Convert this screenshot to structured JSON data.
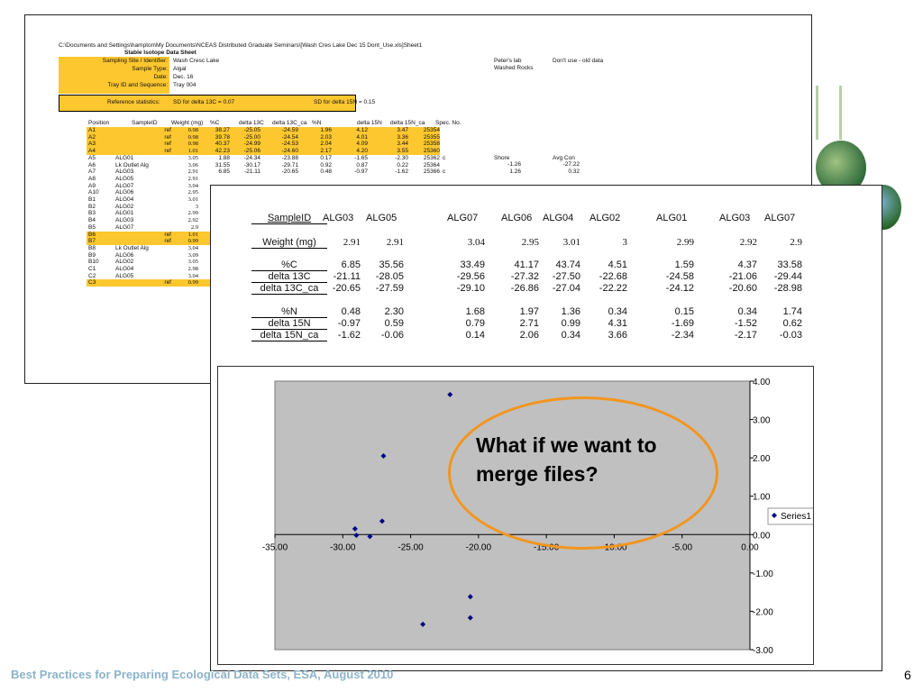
{
  "decor": {
    "tree_icon": "tree-graphic",
    "globe_icon": "globe-photo"
  },
  "sheet1": {
    "path": "C:\\Documents and Settings\\hampton\\My Documents\\NCEAS Distributed Graduate Seminars\\[Wash Cres Lake Dec 15 Dont_Use.xls]Sheet1",
    "title": "Stable Isotope Data Sheet",
    "meta": [
      {
        "label": "Sampling Site / Identifier:",
        "value": "Wash Cresc Lake"
      },
      {
        "label": "Sample Type:",
        "value": "Algal"
      },
      {
        "label": "Date:",
        "value": "Dec. 16"
      },
      {
        "label": "Tray ID and Sequence:",
        "value": "Tray 004"
      }
    ],
    "lab_note": {
      "lab": "Peter's lab",
      "washed": "Washed Rocks",
      "dont_use": "Don't use - old data"
    },
    "ref_stats": {
      "label": "Reference statistics:",
      "sd_c": "SD for delta 13C = 0.07",
      "sd_n": "SD for delta 15N = 0.15"
    },
    "headers": [
      "Position",
      "SampleID",
      "Weight (mg)",
      "%C",
      "delta 13C",
      "delta 13C_ca",
      "%N",
      "delta 15N",
      "delta 15N_ca",
      "Spec. No."
    ],
    "rows": [
      {
        "pos": "A1",
        "id": "",
        "ref": "ref",
        "w": "0.98",
        "c": "38.27",
        "d13": "-25.05",
        "d13ca": "-24.59",
        "n": "1.96",
        "d15": "4.12",
        "d15ca": "3.47",
        "spec": "25354",
        "hl": true
      },
      {
        "pos": "A2",
        "id": "",
        "ref": "ref",
        "w": "0.98",
        "c": "39.78",
        "d13": "-25.00",
        "d13ca": "-24.54",
        "n": "2.03",
        "d15": "4.01",
        "d15ca": "3.36",
        "spec": "25355",
        "hl": true
      },
      {
        "pos": "A3",
        "id": "",
        "ref": "ref",
        "w": "0.98",
        "c": "40.37",
        "d13": "-24.99",
        "d13ca": "-24.53",
        "n": "2.04",
        "d15": "4.09",
        "d15ca": "3.44",
        "spec": "25358",
        "hl": true
      },
      {
        "pos": "A4",
        "id": "",
        "ref": "ref",
        "w": "1.01",
        "c": "42.23",
        "d13": "-25.06",
        "d13ca": "-24.60",
        "n": "2.17",
        "d15": "4.20",
        "d15ca": "3.55",
        "spec": "25360",
        "hl": true
      },
      {
        "pos": "A5",
        "id": "ALG01",
        "ref": "",
        "w": "3.05",
        "c": "1.88",
        "d13": "-24.34",
        "d13ca": "-23.88",
        "n": "0.17",
        "d15": "-1.65",
        "d15ca": "-2.30",
        "spec": "25362",
        "hl": false
      },
      {
        "pos": "A6",
        "id": "Lk Outlet Alg",
        "ref": "",
        "w": "3.06",
        "c": "31.55",
        "d13": "-30.17",
        "d13ca": "-29.71",
        "n": "0.92",
        "d15": "0.87",
        "d15ca": "0.22",
        "spec": "25364",
        "hl": false
      },
      {
        "pos": "A7",
        "id": "ALG03",
        "ref": "",
        "w": "2.91",
        "c": "6.85",
        "d13": "-21.11",
        "d13ca": "-20.65",
        "n": "0.48",
        "d15": "-0.97",
        "d15ca": "-1.62",
        "spec": "25366",
        "hl": false
      },
      {
        "pos": "A8",
        "id": "ALG05",
        "ref": "",
        "w": "2.91",
        "c": "",
        "d13": "",
        "d13ca": "",
        "n": "",
        "d15": "",
        "d15ca": "",
        "spec": "",
        "hl": false
      },
      {
        "pos": "A9",
        "id": "ALG07",
        "ref": "",
        "w": "3.04",
        "c": "",
        "d13": "",
        "d13ca": "",
        "n": "",
        "d15": "",
        "d15ca": "",
        "spec": "",
        "hl": false
      },
      {
        "pos": "A10",
        "id": "ALG06",
        "ref": "",
        "w": "2.95",
        "c": "",
        "d13": "",
        "d13ca": "",
        "n": "",
        "d15": "",
        "d15ca": "",
        "spec": "",
        "hl": false
      },
      {
        "pos": "B1",
        "id": "ALG04",
        "ref": "",
        "w": "3.01",
        "c": "",
        "d13": "",
        "d13ca": "",
        "n": "",
        "d15": "",
        "d15ca": "",
        "spec": "",
        "hl": false
      },
      {
        "pos": "B2",
        "id": "ALG02",
        "ref": "",
        "w": "3",
        "c": "",
        "d13": "",
        "d13ca": "",
        "n": "",
        "d15": "",
        "d15ca": "",
        "spec": "",
        "hl": false
      },
      {
        "pos": "B3",
        "id": "ALG01",
        "ref": "",
        "w": "2.99",
        "c": "",
        "d13": "",
        "d13ca": "",
        "n": "",
        "d15": "",
        "d15ca": "",
        "spec": "",
        "hl": false
      },
      {
        "pos": "B4",
        "id": "ALG03",
        "ref": "",
        "w": "2.92",
        "c": "",
        "d13": "",
        "d13ca": "",
        "n": "",
        "d15": "",
        "d15ca": "",
        "spec": "",
        "hl": false
      },
      {
        "pos": "B5",
        "id": "ALG07",
        "ref": "",
        "w": "2.9",
        "c": "",
        "d13": "",
        "d13ca": "",
        "n": "",
        "d15": "",
        "d15ca": "",
        "spec": "",
        "hl": false
      },
      {
        "pos": "B6",
        "id": "",
        "ref": "ref",
        "w": "1.01",
        "c": "",
        "d13": "",
        "d13ca": "",
        "n": "",
        "d15": "",
        "d15ca": "",
        "spec": "",
        "hl": true
      },
      {
        "pos": "B7",
        "id": "",
        "ref": "ref",
        "w": "0.99",
        "c": "",
        "d13": "",
        "d13ca": "",
        "n": "",
        "d15": "",
        "d15ca": "",
        "spec": "",
        "hl": true
      },
      {
        "pos": "B8",
        "id": "Lk Outlet Alg",
        "ref": "",
        "w": "3.04",
        "c": "",
        "d13": "",
        "d13ca": "",
        "n": "",
        "d15": "",
        "d15ca": "",
        "spec": "",
        "hl": false
      },
      {
        "pos": "B9",
        "id": "ALG06",
        "ref": "",
        "w": "3.09",
        "c": "",
        "d13": "",
        "d13ca": "",
        "n": "",
        "d15": "",
        "d15ca": "",
        "spec": "",
        "hl": false
      },
      {
        "pos": "B10",
        "id": "ALG02",
        "ref": "",
        "w": "3.05",
        "c": "",
        "d13": "",
        "d13ca": "",
        "n": "",
        "d15": "",
        "d15ca": "",
        "spec": "",
        "hl": false
      },
      {
        "pos": "C1",
        "id": "ALG04",
        "ref": "",
        "w": "2.98",
        "c": "",
        "d13": "",
        "d13ca": "",
        "n": "",
        "d15": "",
        "d15ca": "",
        "spec": "",
        "hl": false
      },
      {
        "pos": "C2",
        "id": "ALG05",
        "ref": "",
        "w": "3.04",
        "c": "",
        "d13": "",
        "d13ca": "",
        "n": "",
        "d15": "",
        "d15ca": "",
        "spec": "",
        "hl": false
      },
      {
        "pos": "C3",
        "id": "",
        "ref": "ref",
        "w": "0.99",
        "c": "",
        "d13": "",
        "d13ca": "",
        "n": "",
        "d15": "",
        "d15ca": "",
        "spec": "",
        "hl": true
      }
    ],
    "c_marks": [
      "c",
      "",
      "c"
    ],
    "side": {
      "shore_label": "Shore",
      "avg_label": "Avg Con",
      "rows": [
        {
          "a": "-1.26",
          "b": "-27.22"
        },
        {
          "a": "1.26",
          "b": "0.32"
        }
      ]
    }
  },
  "sheet2": {
    "table": {
      "header_label": "SampleID",
      "columns": [
        "ALG03",
        "ALG05",
        "ALG07",
        "ALG06",
        "ALG04",
        "ALG02",
        "ALG01",
        "ALG03",
        "ALG07"
      ],
      "weight": {
        "label": "Weight (mg)",
        "values": [
          "2.91",
          "2.91",
          "3.04",
          "2.95",
          "3.01",
          "3",
          "2.99",
          "2.92",
          "2.9"
        ]
      },
      "group1": [
        {
          "label": "%C",
          "values": [
            "6.85",
            "35.56",
            "33.49",
            "41.17",
            "43.74",
            "4.51",
            "1.59",
            "4.37",
            "33.58"
          ]
        },
        {
          "label": "delta 13C",
          "values": [
            "-21.11",
            "-28.05",
            "-29.56",
            "-27.32",
            "-27.50",
            "-22.68",
            "-24.58",
            "-21.06",
            "-29.44"
          ]
        },
        {
          "label": "delta 13C_ca",
          "values": [
            "-20.65",
            "-27.59",
            "-29.10",
            "-26.86",
            "-27.04",
            "-22.22",
            "-24.12",
            "-20.60",
            "-28.98"
          ]
        }
      ],
      "group2": [
        {
          "label": "%N",
          "values": [
            "0.48",
            "2.30",
            "1.68",
            "1.97",
            "1.36",
            "0.34",
            "0.15",
            "0.34",
            "1.74"
          ]
        },
        {
          "label": "delta 15N",
          "values": [
            "-0.97",
            "0.59",
            "0.79",
            "2.71",
            "0.99",
            "4.31",
            "-1.69",
            "-1.52",
            "0.62"
          ]
        },
        {
          "label": "delta 15N_ca",
          "values": [
            "-1.62",
            "-0.06",
            "0.14",
            "2.06",
            "0.34",
            "3.66",
            "-2.34",
            "-2.17",
            "-0.03"
          ]
        }
      ]
    }
  },
  "chart_data": {
    "type": "scatter",
    "series": [
      {
        "name": "Series1",
        "points": [
          [
            -22.1,
            3.65
          ],
          [
            -27.0,
            2.05
          ],
          [
            -27.1,
            0.35
          ],
          [
            -28.0,
            -0.05
          ],
          [
            -29.1,
            0.15
          ],
          [
            -29.0,
            -0.02
          ],
          [
            -20.6,
            -1.62
          ],
          [
            -20.6,
            -2.17
          ],
          [
            -24.1,
            -2.34
          ]
        ]
      }
    ],
    "xlim": [
      -35,
      0
    ],
    "ylim": [
      -3,
      4
    ],
    "x_ticks": [
      "-35.00",
      "-30.00",
      "-25.00",
      "-20.00",
      "-15.00",
      "-10.00",
      "-5.00",
      "0.00"
    ],
    "y_ticks": [
      "4.00",
      "3.00",
      "2.00",
      "1.00",
      "0.00",
      "-1.00",
      "-2.00",
      "-3.00"
    ],
    "legend_position": "right",
    "plot_color": "#c0c0c0",
    "point_color": "#00008b"
  },
  "callout": {
    "text": "What if we want to merge files?",
    "color": "#f3951d"
  },
  "footer": {
    "text": "Best Practices for Preparing Ecological Data Sets, ESA, August 2010",
    "page": "6"
  }
}
